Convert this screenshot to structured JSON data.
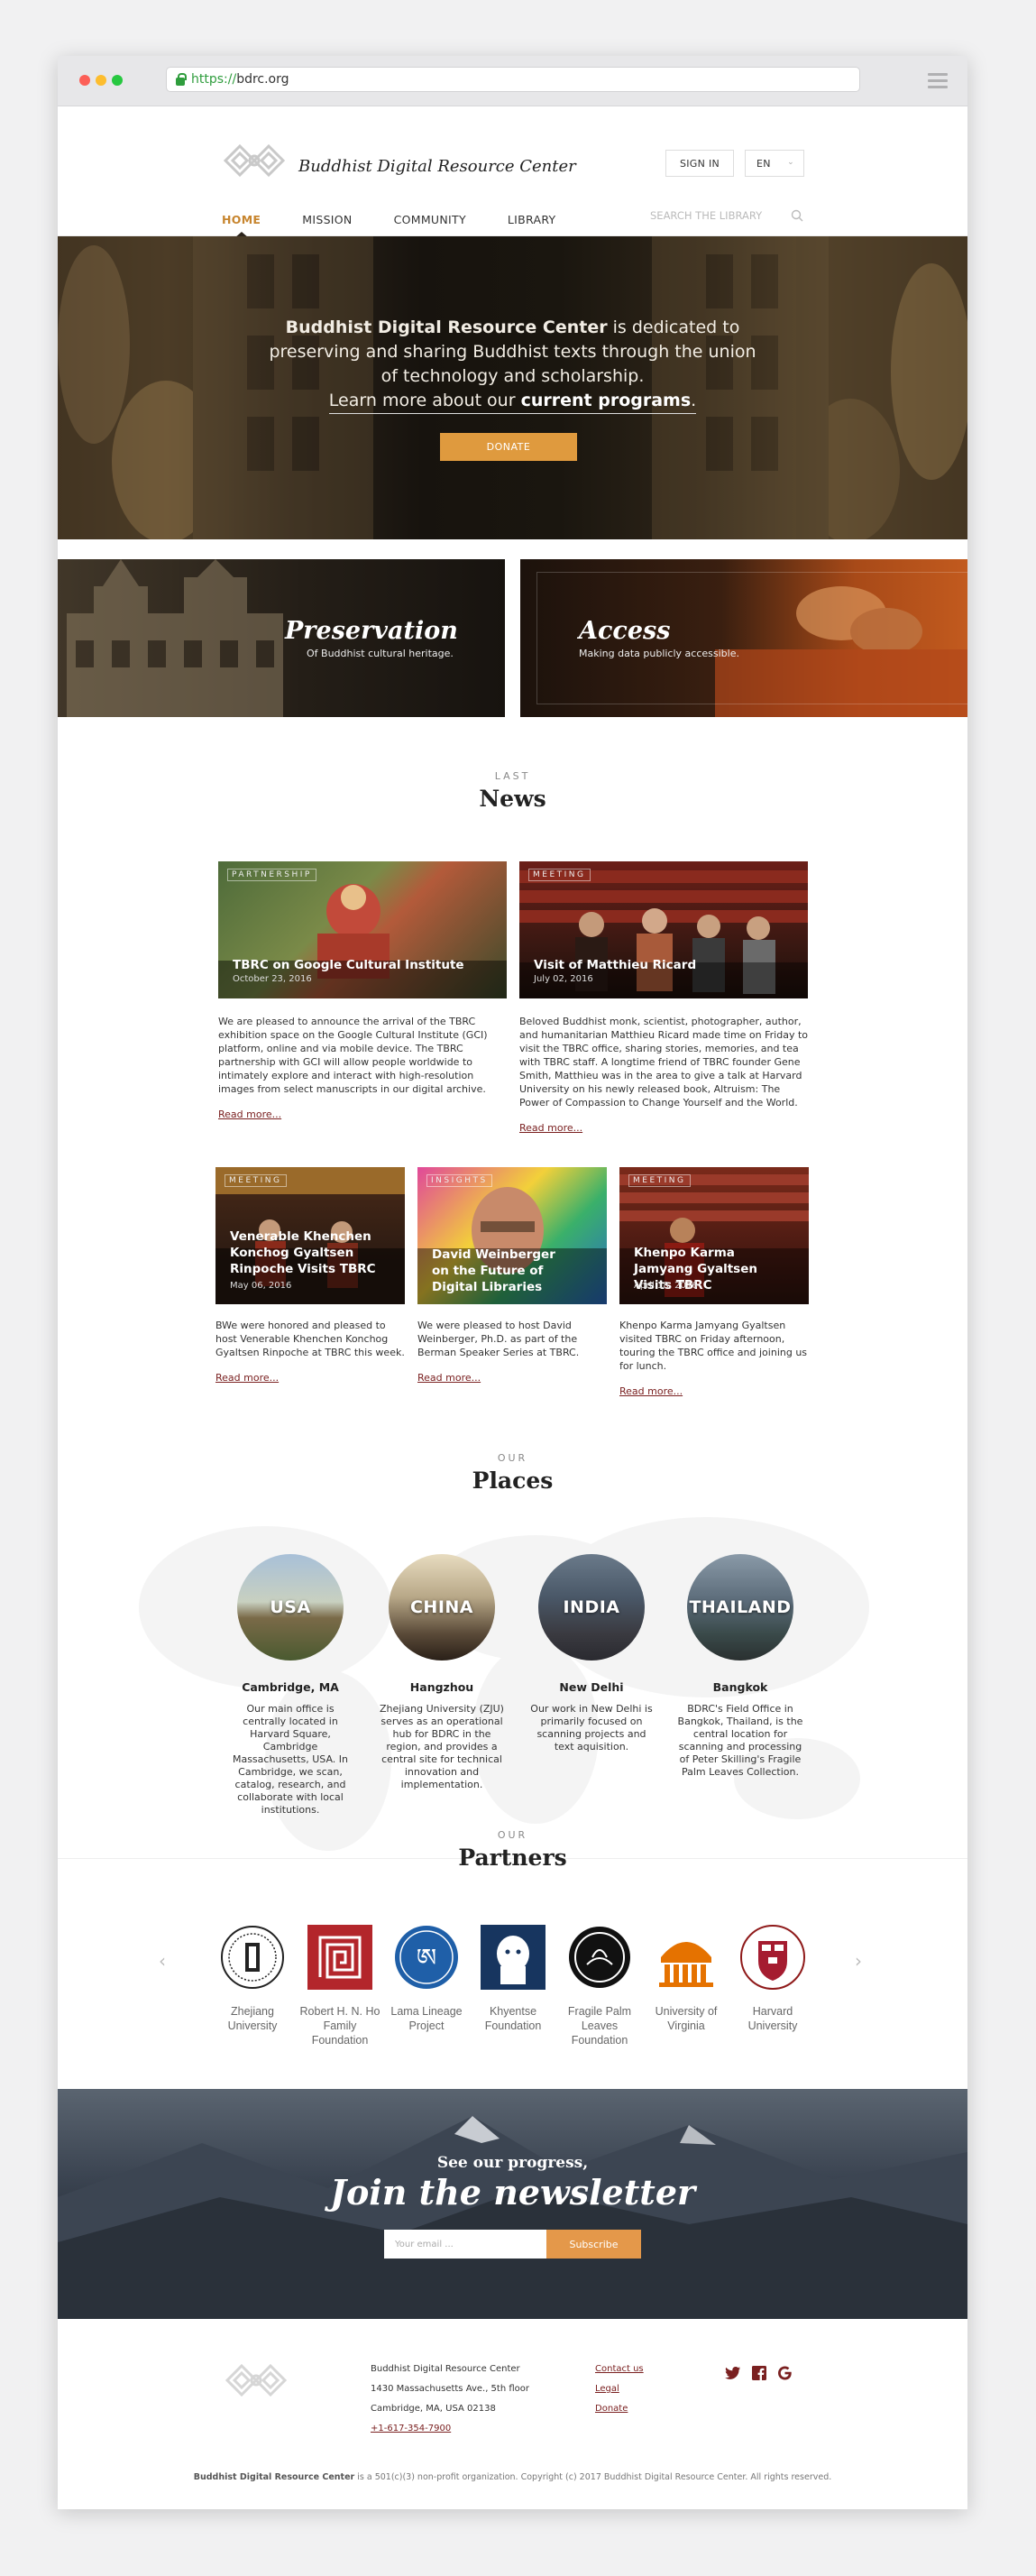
{
  "browser": {
    "url_scheme": "https://",
    "url_host": "bdrc.org"
  },
  "header": {
    "brand": "Buddhist Digital Resource Center",
    "sign_in": "SIGN IN",
    "lang": "EN"
  },
  "nav": {
    "items": [
      "HOME",
      "MISSION",
      "COMMUNITY",
      "LIBRARY"
    ],
    "search_placeholder": "SEARCH THE LIBRARY"
  },
  "hero": {
    "line1_bold": "Buddhist Digital Resource Center",
    "line1_rest": " is dedicated to",
    "line2": "preserving and sharing Buddhist texts through the union",
    "line3": "of technology and scholarship.",
    "line4_pre": "Learn more about our ",
    "line4_link": "current programs",
    "line4_post": ".",
    "donate": "DONATE"
  },
  "tiles": [
    {
      "title": "Preservation",
      "subtitle": "Of Buddhist cultural heritage."
    },
    {
      "title": "Access",
      "subtitle": "Making data publicly accessible."
    }
  ],
  "news_section": {
    "kicker": "LAST",
    "title": "News",
    "read_more": "Read more..."
  },
  "news": [
    {
      "tag": "PARTNERSHIP",
      "title": "TBRC on Google Cultural Institute",
      "date": "October 23, 2016",
      "body": "We are pleased to announce the arrival of the TBRC exhibition space on the Google Cultural Institute (GCI) platform, online and via mobile device. The TBRC partnership with GCI will allow people worldwide to intimately explore and interact with high-resolution images from select manuscripts in our digital archive."
    },
    {
      "tag": "MEETING",
      "title": "Visit of Matthieu Ricard",
      "date": "July 02, 2016",
      "body": "Beloved Buddhist monk, scientist, photographer, author, and humanitarian Matthieu Ricard made time on Friday to visit the TBRC office, sharing stories, memories, and tea with TBRC staff. A longtime friend of TBRC founder Gene Smith, Matthieu was in the area to give a talk at Harvard University on his newly released book, Altruism: The Power of Compassion to Change Yourself and the World."
    },
    {
      "tag": "MEETING",
      "title": "Venerable Khenchen Konchog Gyaltsen Rinpoche Visits TBRC",
      "date": "May 06, 2016",
      "body": "BWe were honored and pleased to host Venerable Khenchen Konchog Gyaltsen Rinpoche at TBRC this week."
    },
    {
      "tag": "INSIGHTS",
      "title": "David Weinberger on the Future of Digital Libraries",
      "date": "",
      "body": "We were pleased to host David Weinberger, Ph.D. as part of the Berman Speaker Series at TBRC."
    },
    {
      "tag": "MEETING",
      "title": "Khenpo Karma Jamyang Gyaltsen Visits TBRC",
      "date": "April 18, 2016",
      "body": "Khenpo Karma Jamyang Gyaltsen visited TBRC on Friday afternoon, touring the TBRC office and joining us for lunch."
    }
  ],
  "places_section": {
    "kicker": "OUR",
    "title": "Places"
  },
  "places": [
    {
      "label": "USA",
      "name": "Cambridge, MA",
      "desc": "Our main office is centrally located in Harvard Square, Cambridge Massachusetts, USA. In Cambridge, we scan, catalog, research, and collaborate with local institutions."
    },
    {
      "label": "CHINA",
      "name": "Hangzhou",
      "desc": "Zhejiang University (ZJU) serves as an operational hub for BDRC in the region, and provides a central site for technical innovation and implementation."
    },
    {
      "label": "INDIA",
      "name": "New Delhi",
      "desc": "Our work in New Delhi is primarily focused on scanning projects and text aquisition."
    },
    {
      "label": "THAILAND",
      "name": "Bangkok",
      "desc": "BDRC's Field Office in Bangkok, Thailand, is the central location for scanning and processing of Peter Skilling's Fragile Palm Leaves Collection."
    }
  ],
  "partners_section": {
    "kicker": "OUR",
    "title": "Partners"
  },
  "partners": [
    {
      "name": "Zhejiang University",
      "icon": "zhejiang-seal-icon"
    },
    {
      "name": "Robert H. N. Ho Family Foundation",
      "icon": "ho-foundation-icon"
    },
    {
      "name": "Lama Lineage Project",
      "icon": "lama-lineage-icon"
    },
    {
      "name": "Khyentse Foundation",
      "icon": "khyentse-lion-icon"
    },
    {
      "name": "Fragile Palm Leaves Foundation",
      "icon": "palm-leaves-icon"
    },
    {
      "name": "University of Virginia",
      "icon": "uva-rotunda-icon"
    },
    {
      "name": "Harvard University",
      "icon": "harvard-shield-icon"
    }
  ],
  "newsletter": {
    "kicker": "See our progress,",
    "title": "Join the newsletter",
    "placeholder": "Your email ...",
    "button": "Subscribe"
  },
  "footer": {
    "org": "Buddhist Digital Resource Center",
    "address1": "1430 Massachusetts Ave., 5th floor",
    "address2": "Cambridge, MA, USA 02138",
    "phone": "+1-617-354-7900",
    "links": [
      "Contact us",
      "Legal",
      "Donate"
    ],
    "copy_bold": "Buddhist Digital Resource Center",
    "copy_rest": " is a 501(c)(3) non-profit organization. Copyright (c) 2017 Buddhist Digital Resource Center. All rights reserved."
  },
  "colors": {
    "accent": "#c7852e",
    "donate": "#df9a3e",
    "link": "#7a2020"
  }
}
